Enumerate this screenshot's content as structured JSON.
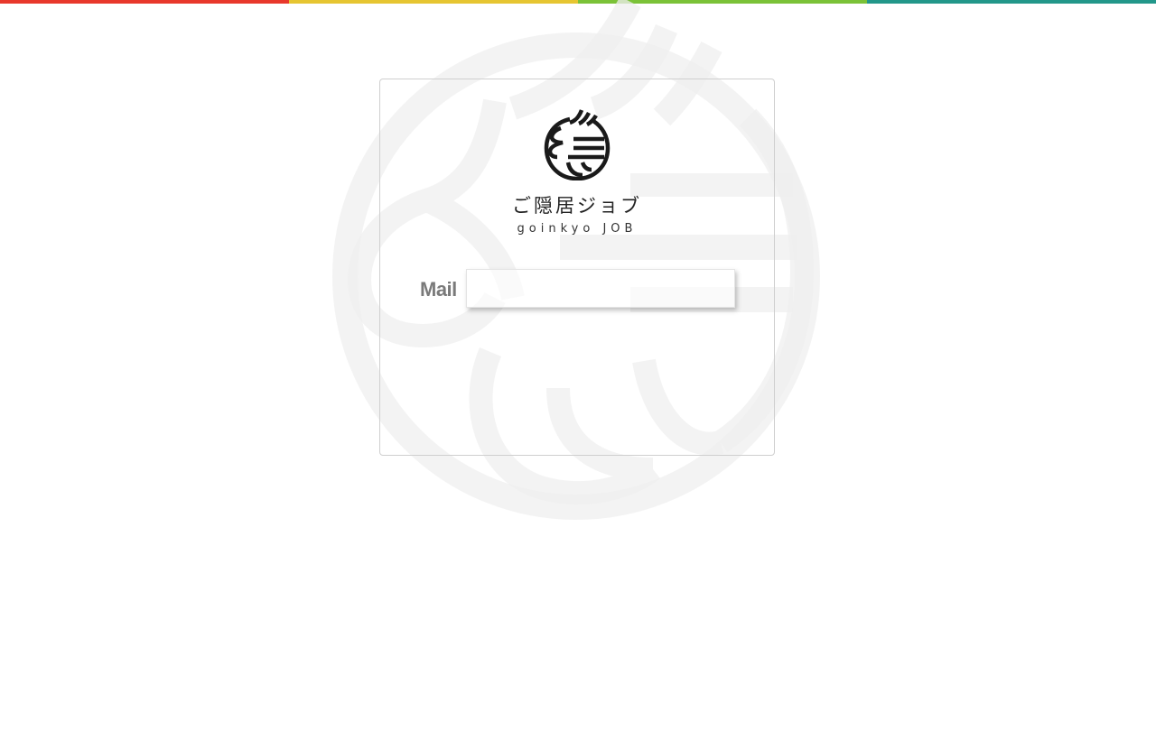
{
  "page": {
    "stripe_colors": [
      "#e8382b",
      "#e6c531",
      "#7bc238",
      "#22978a"
    ]
  },
  "brand": {
    "name_jp": "ご隠居ジョブ",
    "name_en": "goinkyo JOB",
    "logo_icon": "goinkyo-logo-icon",
    "watermark_icon": "goinkyo-watermark-icon"
  },
  "form": {
    "mail_label": "Mail",
    "mail_value": "",
    "mail_placeholder": ""
  }
}
